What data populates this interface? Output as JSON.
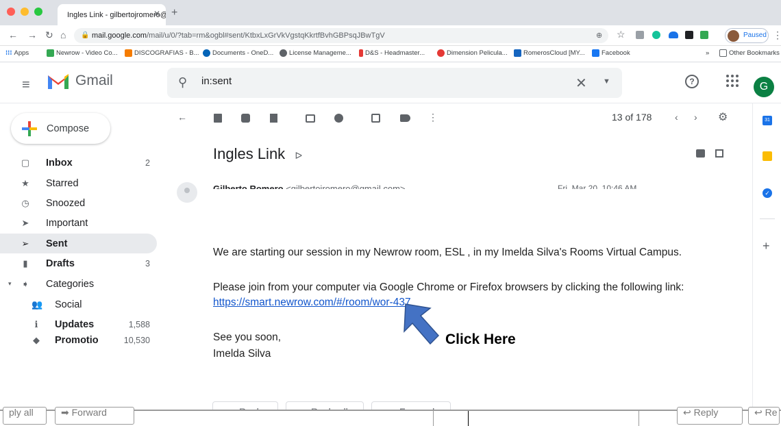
{
  "browser": {
    "tab_title": "Ingles Link - gilbertojromero@gm",
    "url_host": "mail.google.com",
    "url_path": "/mail/u/0/?tab=rm&ogbl#sent/KtbxLxGrVkVgstqKkrtfBvhGBPsqJBwTgV",
    "profile_status": "Paused",
    "bookmarks": [
      "Apps",
      "Newrow - Video Co...",
      "DISCOGRAFIAS - B...",
      "Documents - OneD...",
      "License Manageme...",
      "D&S - Headmaster...",
      "Dimension Pelicula...",
      "RomerosCloud [MY...",
      "Facebook"
    ],
    "other_bookmarks": "Other Bookmarks",
    "more_bookmarks": "»"
  },
  "gmail": {
    "logo_text": "Gmail",
    "search_value": "in:sent",
    "avatar_letter": "G",
    "compose_label": "Compose",
    "nav": [
      {
        "label": "Inbox",
        "count": "2",
        "icon": "inbox-icon"
      },
      {
        "label": "Starred",
        "count": "",
        "icon": "star-icon"
      },
      {
        "label": "Snoozed",
        "count": "",
        "icon": "clock-icon"
      },
      {
        "label": "Important",
        "count": "",
        "icon": "important-icon"
      },
      {
        "label": "Sent",
        "count": "",
        "icon": "send-icon"
      },
      {
        "label": "Drafts",
        "count": "3",
        "icon": "draft-icon"
      },
      {
        "label": "Categories",
        "count": "",
        "icon": "label-icon"
      },
      {
        "label": "Social",
        "count": "",
        "icon": "people-icon"
      },
      {
        "label": "Updates",
        "count": "1,588",
        "icon": "info-icon"
      },
      {
        "label": "Promotio",
        "count": "10,530",
        "icon": "tag-icon"
      }
    ],
    "pagination": "13 of 178"
  },
  "message": {
    "subject": "Ingles Link",
    "sender": "Gilberto Romero",
    "sender_email": "<gilbertojromero@gmail.com>",
    "date": "Fri, Mar 20, 10:46 AM",
    "line1": "We are starting our session in my Newrow room, ESL , in my Imelda Silva's Rooms Virtual Campus.",
    "line2": "Please join from your computer via Google Chrome or Firefox browsers by clicking the following link:",
    "link": "https://smart.newrow.com/#/room/wor-437",
    "closing1": "See you soon,",
    "closing2": "Imelda Silva",
    "reply_label": "Reply",
    "reply_all_label": "Reply all",
    "forward_label": "Forward"
  },
  "annotation": {
    "callout": "Click Here",
    "arrow_color": "#4472c4"
  },
  "bottom_strip": {
    "reply_all": "ply all",
    "forward": "Forward",
    "reply": "Reply",
    "re": "Re"
  }
}
